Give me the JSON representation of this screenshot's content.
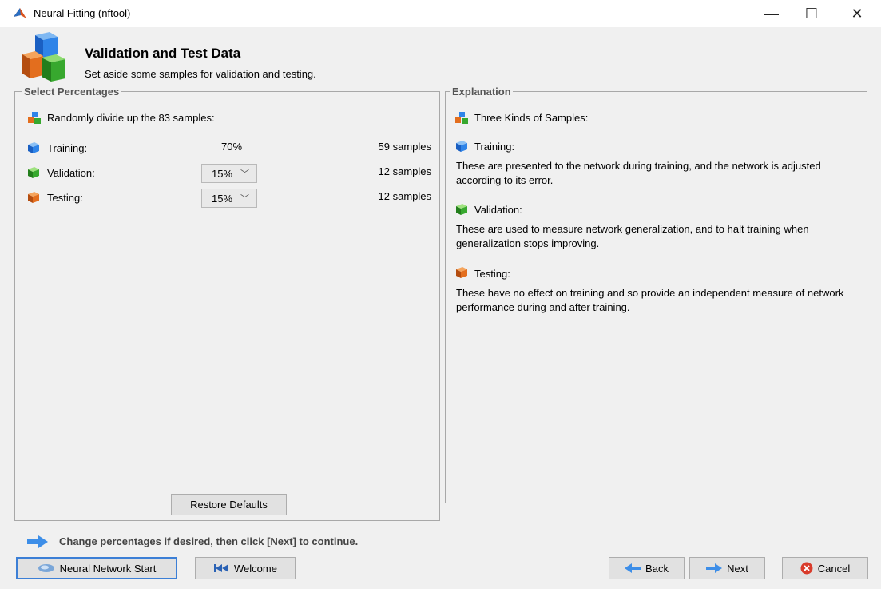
{
  "window": {
    "title": "Neural Fitting (nftool)",
    "controls": {
      "minimize": "—",
      "maximize": "☐",
      "close": "✕"
    }
  },
  "header": {
    "title": "Validation and Test Data",
    "subtitle": "Set aside some samples for validation and testing.",
    "icon": "cubes-logo-icon"
  },
  "left_panel": {
    "legend": "Select Percentages",
    "intro": "Randomly divide up the 83 samples:",
    "rows": [
      {
        "label": "Training:",
        "percent": "70%",
        "samples": "59 samples",
        "color": "#1f6fd6"
      },
      {
        "label": "Validation:",
        "percent": "15%",
        "samples": "12 samples",
        "color": "#2e9b2e"
      },
      {
        "label": "Testing:",
        "percent": "15%",
        "samples": "12 samples",
        "color": "#d96a1c"
      }
    ],
    "restore_label": "Restore Defaults"
  },
  "right_panel": {
    "legend": "Explanation",
    "intro": "Three Kinds of Samples:",
    "items": [
      {
        "title": "Training:",
        "text": "These are presented to the network during training, and the network is adjusted according to its error."
      },
      {
        "title": "Validation:",
        "text": "These are used to measure network generalization, and to halt training when generalization stops improving."
      },
      {
        "title": "Testing:",
        "text": "These have no effect on training and so provide an independent measure of network performance during and after training."
      }
    ]
  },
  "hint": "Change percentages if desired, then click [Next] to continue.",
  "footer": {
    "nnstart": "Neural Network Start",
    "welcome": "Welcome",
    "back": "Back",
    "next": "Next",
    "cancel": "Cancel"
  }
}
